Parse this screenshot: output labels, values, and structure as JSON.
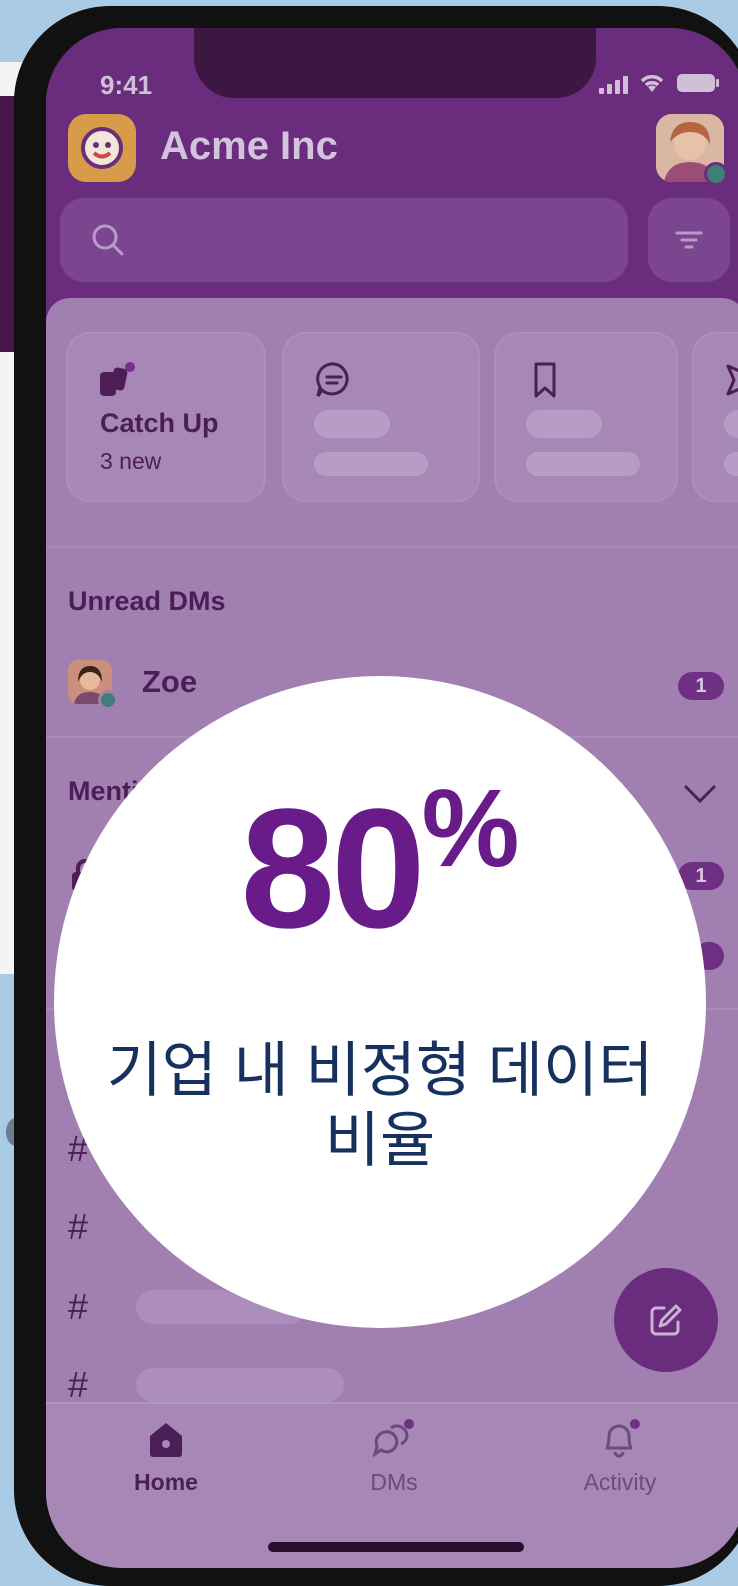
{
  "status_bar": {
    "time": "9:41"
  },
  "header": {
    "workspace_name": "Acme Inc"
  },
  "quick_cards": [
    {
      "title": "Catch Up",
      "subtitle": "3 new"
    }
  ],
  "sections": {
    "unread_dms": {
      "title": "Unread DMs",
      "items": [
        {
          "name": "Zoe",
          "badge": "1"
        }
      ]
    },
    "mentions": {
      "title": "Mentions",
      "items": [
        {
          "badge": "1"
        }
      ]
    }
  },
  "tabbar": {
    "home": "Home",
    "dms": "DMs",
    "activity": "Activity"
  },
  "stat_overlay": {
    "value": "80",
    "unit": "%",
    "caption": "기업 내 비정형 데이터 비율"
  },
  "colors": {
    "brand_purple": "#6a2c7c",
    "stat_purple": "#6a1b8a",
    "caption_navy": "#16315e"
  }
}
